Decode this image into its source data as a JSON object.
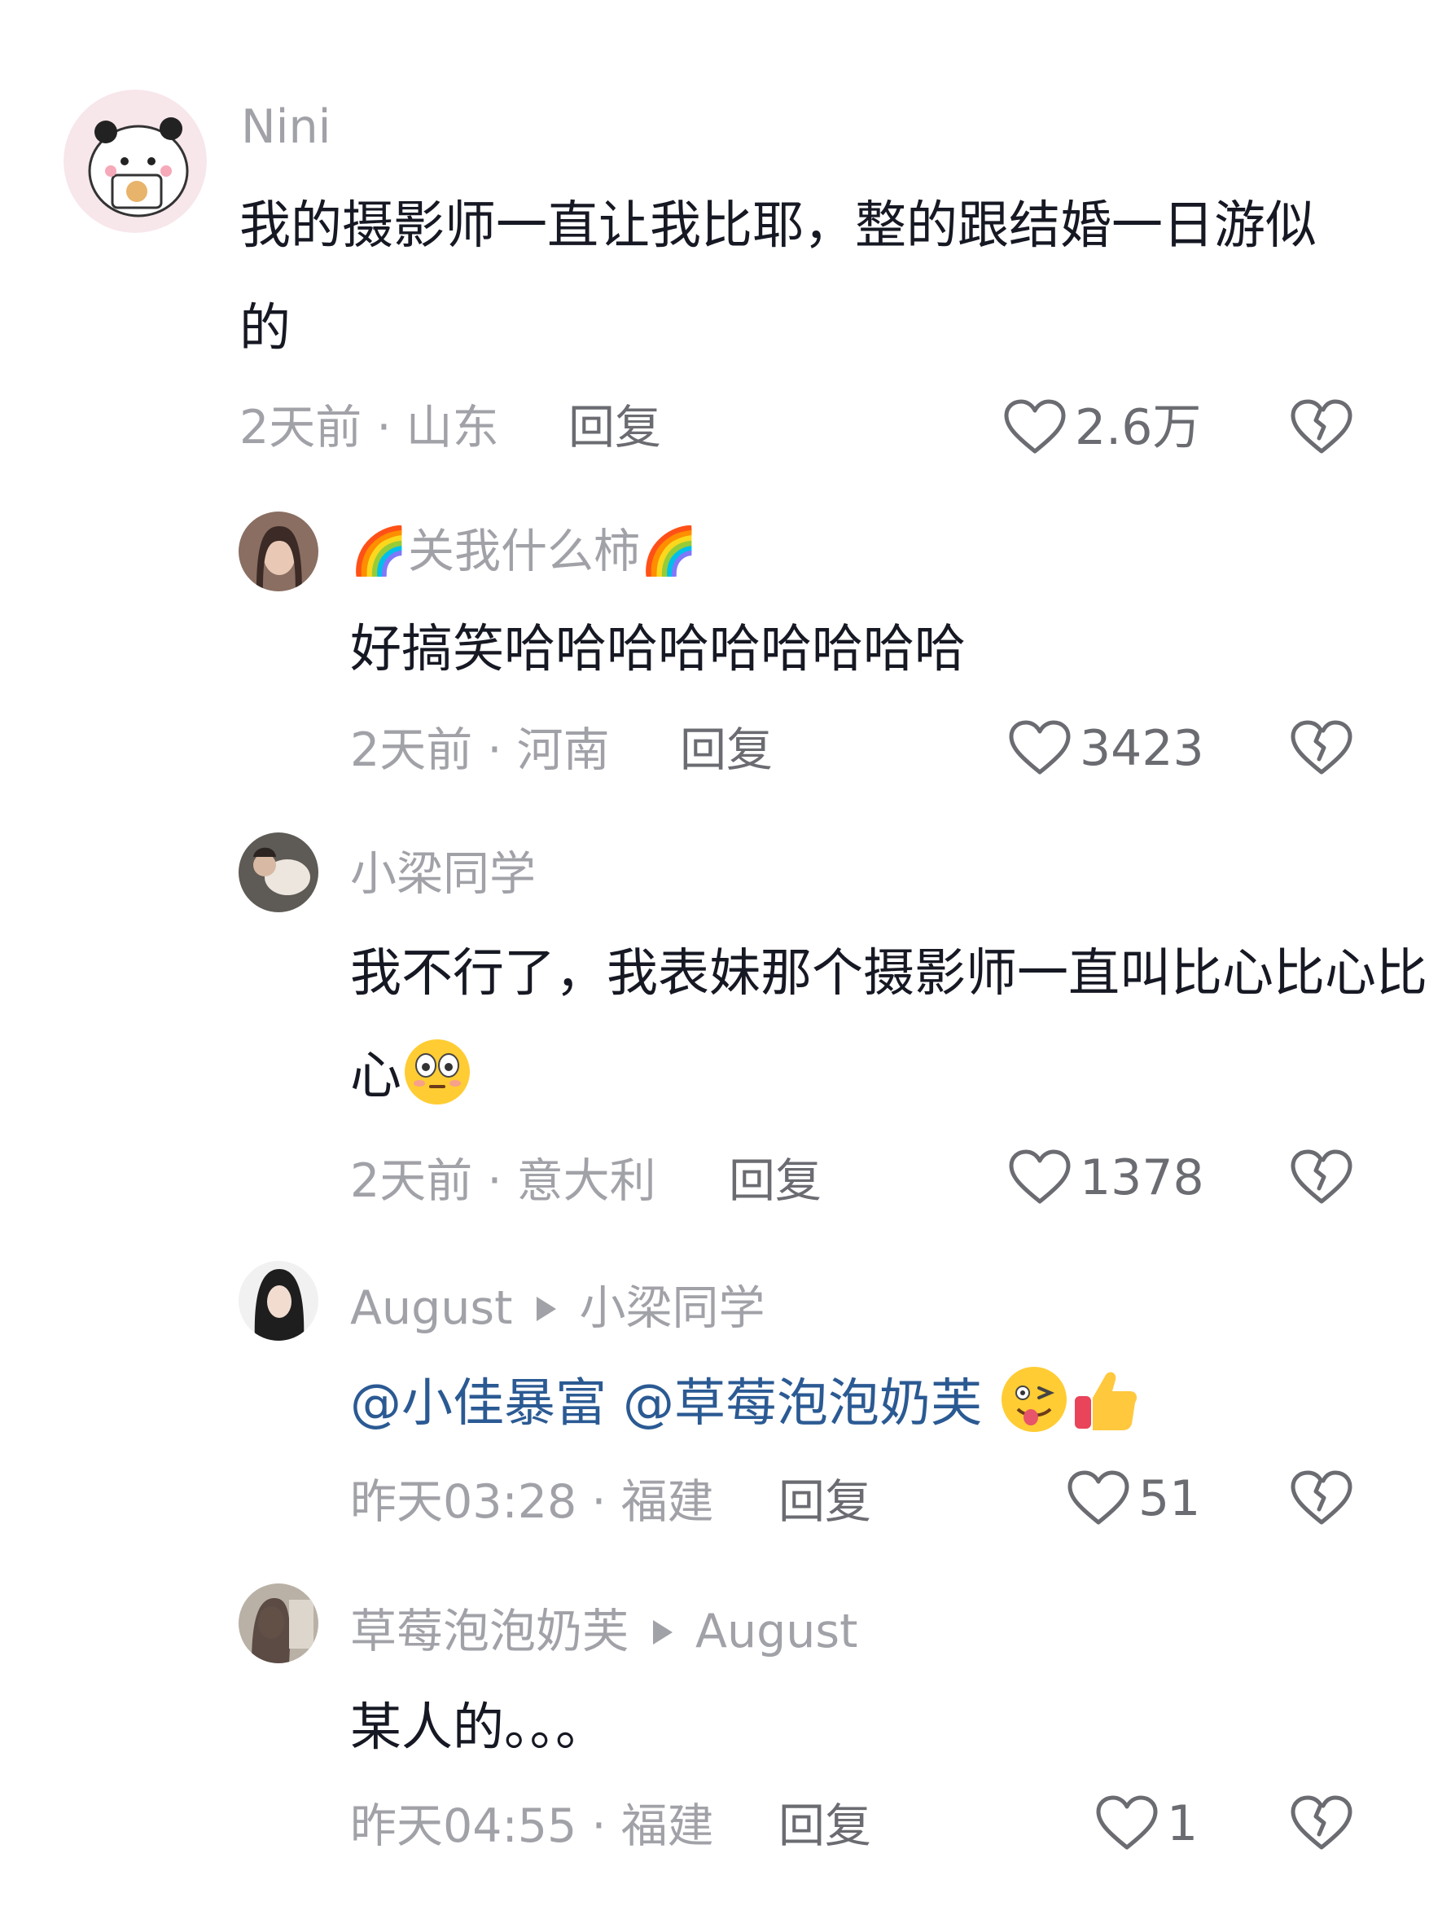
{
  "comments": [
    {
      "user": "Nini",
      "text": "我的摄影师一直让我比耶，整的跟结婚一日游似的",
      "time_location": "2天前 · 山东",
      "reply_label": "回复",
      "likes": "2.6万"
    },
    {
      "user": "🌈关我什么柿🌈",
      "text": "好搞笑哈哈哈哈哈哈哈哈哈",
      "time_location": "2天前 · 河南",
      "reply_label": "回复",
      "likes": "3423"
    },
    {
      "user": "小梁同学",
      "text": "我不行了，我表妹那个摄影师一直叫比心比心比心",
      "emoji": "flushed-face",
      "time_location": "2天前 · 意大利",
      "reply_label": "回复",
      "likes": "1378"
    },
    {
      "user": "August",
      "reply_to": "小梁同学",
      "mention_1": "@小佳暴富",
      "mention_2": "@草莓泡泡奶芙",
      "emojis": [
        "winking-tongue-face",
        "thumbs-up"
      ],
      "time_location": "昨天03:28 · 福建",
      "reply_label": "回复",
      "likes": "51"
    },
    {
      "user": "草莓泡泡奶芙",
      "reply_to": "August",
      "text": "某人的。。。",
      "time_location": "昨天04:55 · 福建",
      "reply_label": "回复",
      "likes": "1"
    }
  ],
  "colors": {
    "text": "#161823",
    "secondary": "#a1a2a8",
    "action": "#6b6c72",
    "mention": "#2b5a93"
  }
}
